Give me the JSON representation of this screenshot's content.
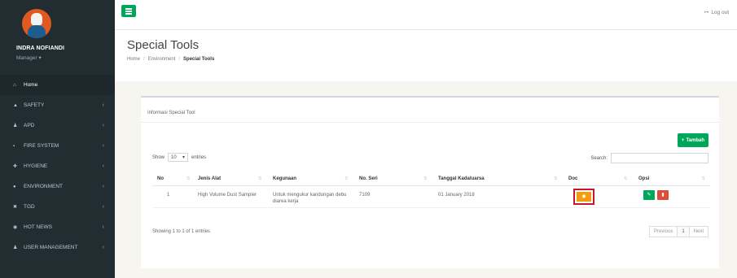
{
  "user": {
    "name": "INDRA NOFIANDI",
    "role": "Manager ▾"
  },
  "sidebar": {
    "items": [
      {
        "icon": "⌂",
        "label": "Home",
        "chevron": ""
      },
      {
        "icon": "▲",
        "label": "SAFETY",
        "chevron": "‹"
      },
      {
        "icon": "♟",
        "label": "APD",
        "chevron": "‹"
      },
      {
        "icon": "▪",
        "label": "FIRE SYSTEM",
        "chevron": "‹"
      },
      {
        "icon": "✚",
        "label": "HYGIENE",
        "chevron": "‹"
      },
      {
        "icon": "●",
        "label": "ENVIRONMENT",
        "chevron": "‹"
      },
      {
        "icon": "✖",
        "label": "TGD",
        "chevron": "‹"
      },
      {
        "icon": "◉",
        "label": "HOT NEWS",
        "chevron": "‹"
      },
      {
        "icon": "♟",
        "label": "USER MANAGEMENT",
        "chevron": "‹"
      }
    ]
  },
  "topbar": {
    "logout_icon": "↦",
    "logout_label": "Log out"
  },
  "header": {
    "title": "Special Tools",
    "breadcrumb": [
      "Home",
      "Environment",
      "Special Tools"
    ]
  },
  "box": {
    "title": "Informasi Special Tool",
    "add_label": "Tambah",
    "add_icon": "+",
    "show_label": "Show",
    "show_value": "10",
    "entries_label": "entries",
    "search_label": "Search:",
    "search_value": "",
    "columns": [
      "No",
      "Jenis Alat",
      "Kegunaan",
      "No. Seri",
      "Tanggal Kadaluarsa",
      "Doc",
      "Opsi"
    ],
    "rows": [
      {
        "no": "1",
        "jenis_alat": "High Volume Dust Sampler",
        "kegunaan": "Untuk mengukur kandungan debu diarea kerja",
        "no_seri": "7109",
        "tanggal": "01 January 2018"
      }
    ],
    "info": "Showing 1 to 1 of 1 entries",
    "pager": {
      "previous": "Previous",
      "page": "1",
      "next": "Next"
    }
  },
  "colors": {
    "sidebar_bg": "#222d32",
    "accent_green": "#00a65a",
    "doc_orange": "#f39c12",
    "delete_red": "#dd4b39",
    "highlight_border": "#c9162b"
  }
}
